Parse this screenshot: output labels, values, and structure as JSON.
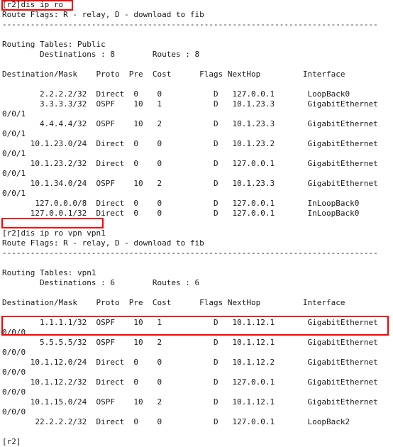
{
  "terminal": {
    "device_prompt": "[r2]",
    "final_prompt": "[r2]",
    "separator": "--------------------------------------------------------------------------------",
    "route_flags_legend": "Route Flags: R - relay, D - download to fib",
    "column_header": "Destination/Mask    Proto  Pre  Cost      Flags NextHop         Interface",
    "sessions": [
      {
        "command_line": "[r2]dis ip ro",
        "command": "dis ip ro",
        "tables_label": "Routing Tables: Public",
        "table_name": "Public",
        "summary_line": "        Destinations : 8        Routes : 8",
        "destinations": "8",
        "routes": "8",
        "rows": [
          {
            "destination": "2.2.2.2/32",
            "proto": "Direct",
            "pre": "0",
            "cost": "0",
            "flags": "D",
            "nexthop": "127.0.0.1",
            "interface": "LoopBack0",
            "interface_wrap": "",
            "text": "        2.2.2.2/32  Direct  0    0           D   127.0.0.1       LoopBack0"
          },
          {
            "destination": "3.3.3.3/32",
            "proto": "OSPF",
            "pre": "10",
            "cost": "1",
            "flags": "D",
            "nexthop": "10.1.23.3",
            "interface": "GigabitEthernet",
            "interface_wrap": "0/0/1",
            "text": "        3.3.3.3/32  OSPF    10   1           D   10.1.23.3       GigabitEthernet"
          },
          {
            "destination": "4.4.4.4/32",
            "proto": "OSPF",
            "pre": "10",
            "cost": "2",
            "flags": "D",
            "nexthop": "10.1.23.3",
            "interface": "GigabitEthernet",
            "interface_wrap": "0/0/1",
            "text": "        4.4.4.4/32  OSPF    10   2           D   10.1.23.3       GigabitEthernet"
          },
          {
            "destination": "10.1.23.0/24",
            "proto": "Direct",
            "pre": "0",
            "cost": "0",
            "flags": "D",
            "nexthop": "10.1.23.2",
            "interface": "GigabitEthernet",
            "interface_wrap": "0/0/1",
            "text": "      10.1.23.0/24  Direct  0    0           D   10.1.23.2       GigabitEthernet"
          },
          {
            "destination": "10.1.23.2/32",
            "proto": "Direct",
            "pre": "0",
            "cost": "0",
            "flags": "D",
            "nexthop": "127.0.0.1",
            "interface": "GigabitEthernet",
            "interface_wrap": "0/0/1",
            "text": "      10.1.23.2/32  Direct  0    0           D   127.0.0.1       GigabitEthernet"
          },
          {
            "destination": "10.1.34.0/24",
            "proto": "OSPF",
            "pre": "10",
            "cost": "2",
            "flags": "D",
            "nexthop": "10.1.23.3",
            "interface": "GigabitEthernet",
            "interface_wrap": "0/0/1",
            "text": "      10.1.34.0/24  OSPF    10   2           D   10.1.23.3       GigabitEthernet"
          },
          {
            "destination": "127.0.0.0/8",
            "proto": "Direct",
            "pre": "0",
            "cost": "0",
            "flags": "D",
            "nexthop": "127.0.0.1",
            "interface": "InLoopBack0",
            "interface_wrap": "",
            "text": "       127.0.0.0/8  Direct  0    0           D   127.0.0.1       InLoopBack0"
          },
          {
            "destination": "127.0.0.1/32",
            "proto": "Direct",
            "pre": "0",
            "cost": "0",
            "flags": "D",
            "nexthop": "127.0.0.1",
            "interface": "InLoopBack0",
            "interface_wrap": "",
            "text": "      127.0.0.1/32  Direct  0    0           D   127.0.0.1       InLoopBack0"
          }
        ]
      },
      {
        "command_line": "[r2]dis ip ro vpn vpn1",
        "command": "dis ip ro vpn vpn1",
        "tables_label": "Routing Tables: vpn1",
        "table_name": "vpn1",
        "summary_line": "        Destinations : 6        Routes : 6",
        "destinations": "6",
        "routes": "6",
        "rows": [
          {
            "destination": "1.1.1.1/32",
            "proto": "OSPF",
            "pre": "10",
            "cost": "1",
            "flags": "D",
            "nexthop": "10.1.12.1",
            "interface": "GigabitEthernet",
            "interface_wrap": "0/0/0",
            "text": "        1.1.1.1/32  OSPF    10   1           D   10.1.12.1       GigabitEthernet"
          },
          {
            "destination": "5.5.5.5/32",
            "proto": "OSPF",
            "pre": "10",
            "cost": "2",
            "flags": "D",
            "nexthop": "10.1.12.1",
            "interface": "GigabitEthernet",
            "interface_wrap": "0/0/0",
            "highlighted": true,
            "text": "        5.5.5.5/32  OSPF    10   2           D   10.1.12.1       GigabitEthernet"
          },
          {
            "destination": "10.1.12.0/24",
            "proto": "Direct",
            "pre": "0",
            "cost": "0",
            "flags": "D",
            "nexthop": "10.1.12.2",
            "interface": "GigabitEthernet",
            "interface_wrap": "0/0/0",
            "text": "      10.1.12.0/24  Direct  0    0           D   10.1.12.2       GigabitEthernet"
          },
          {
            "destination": "10.1.12.2/32",
            "proto": "Direct",
            "pre": "0",
            "cost": "0",
            "flags": "D",
            "nexthop": "127.0.0.1",
            "interface": "GigabitEthernet",
            "interface_wrap": "0/0/0",
            "text": "      10.1.12.2/32  Direct  0    0           D   127.0.0.1       GigabitEthernet"
          },
          {
            "destination": "10.1.15.0/24",
            "proto": "OSPF",
            "pre": "10",
            "cost": "2",
            "flags": "D",
            "nexthop": "10.1.12.1",
            "interface": "GigabitEthernet",
            "interface_wrap": "0/0/0",
            "text": "      10.1.15.0/24  OSPF    10   2           D   10.1.12.1       GigabitEthernet"
          },
          {
            "destination": "22.2.2.2/32",
            "proto": "Direct",
            "pre": "0",
            "cost": "0",
            "flags": "D",
            "nexthop": "127.0.0.1",
            "interface": "LoopBack2",
            "interface_wrap": "",
            "text": "       22.2.2.2/32  Direct  0    0           D   127.0.0.1       LoopBack2"
          }
        ]
      }
    ],
    "annotations": {
      "highlight_color": "#ff0000",
      "boxes": [
        {
          "name": "command-1",
          "label": "dis ip ro"
        },
        {
          "name": "command-2",
          "label": "dis ip ro vpn vpn1"
        },
        {
          "name": "route-5.5.5.5",
          "label": "5.5.5.5/32"
        }
      ]
    }
  }
}
